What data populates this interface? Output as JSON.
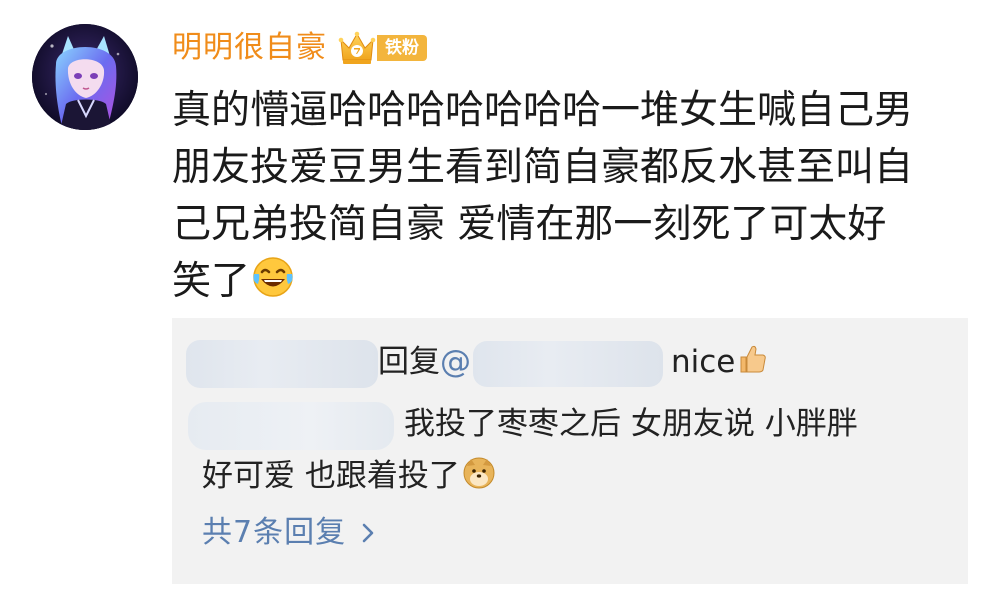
{
  "post": {
    "username": "明明很自豪",
    "badge": {
      "label": "铁粉",
      "icon": "crown-fan-badge-icon",
      "color": "#f3b53d"
    },
    "comment_lines": [
      "真的懵逼哈哈哈哈哈哈哈一堆女生喊自己男",
      "朋友投爱豆男生看到简自豪都反水甚至叫自",
      "己兄弟投简自豪 爱情在那一刻死了可太好",
      "笑了"
    ],
    "comment_emoji": "laughing-tears-emoji"
  },
  "replies": {
    "reply1": {
      "verb": "回复",
      "mention_prefix": "@",
      "text": "nice",
      "emoji": "thumbs-up-emoji"
    },
    "reply2": {
      "text_line1": "我投了枣枣之后 女朋友说 小胖胖",
      "text_line2": "好可爱 也跟着投了",
      "emoji": "doge-emoji"
    },
    "more_label": "共7条回复",
    "more_icon": "chevron-right-icon"
  },
  "colors": {
    "username": "#f08c1a",
    "link": "#5b7fb0",
    "reply_bg": "#f2f2f2"
  }
}
